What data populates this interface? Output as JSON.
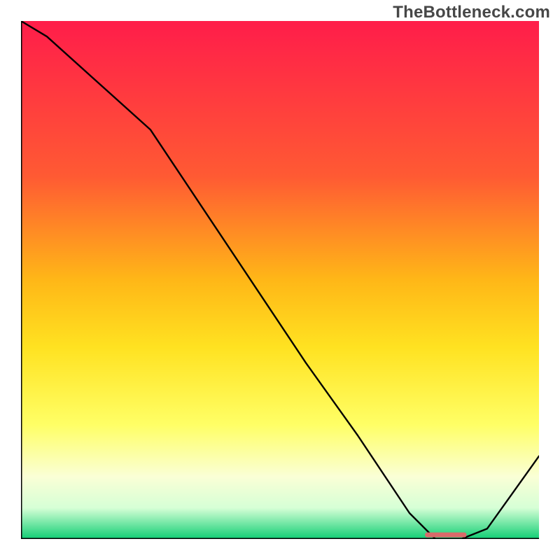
{
  "watermark": "TheBottleneck.com",
  "chart_data": {
    "type": "line",
    "title": "",
    "xlabel": "",
    "ylabel": "",
    "xlim": [
      0,
      100
    ],
    "ylim": [
      0,
      100
    ],
    "x": [
      0,
      5,
      25,
      35,
      45,
      55,
      65,
      75,
      80,
      85,
      90,
      100
    ],
    "values": [
      100,
      97,
      79,
      64,
      49,
      34,
      20,
      5,
      0,
      0,
      2,
      16
    ],
    "marker": {
      "x_start": 78,
      "x_end": 86,
      "y": 0.8,
      "color": "#d96a6a"
    },
    "gradient_stops": [
      {
        "offset": 0,
        "color": "#ff1d4a"
      },
      {
        "offset": 0.3,
        "color": "#ff5a33"
      },
      {
        "offset": 0.5,
        "color": "#ffb717"
      },
      {
        "offset": 0.63,
        "color": "#ffe221"
      },
      {
        "offset": 0.78,
        "color": "#ffff66"
      },
      {
        "offset": 0.88,
        "color": "#faffd6"
      },
      {
        "offset": 0.94,
        "color": "#d6ffd6"
      },
      {
        "offset": 0.995,
        "color": "#21d27c"
      },
      {
        "offset": 1.0,
        "color": "#19c87a"
      }
    ],
    "axis_color": "#000000",
    "line_color": "#000000"
  }
}
